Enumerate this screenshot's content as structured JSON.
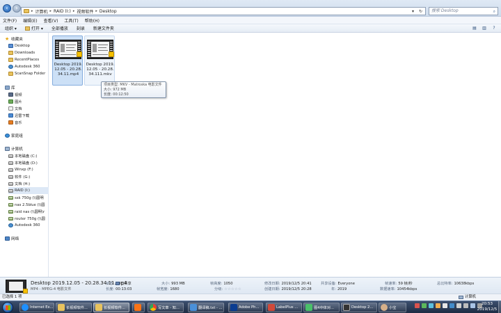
{
  "address_bar": {
    "path": [
      "计算机",
      "RAID (I:)",
      "视频软件",
      "Desktop"
    ],
    "search_placeholder": "搜索 Desktop"
  },
  "menu": [
    "文件(F)",
    "编辑(E)",
    "查看(V)",
    "工具(T)",
    "帮助(H)"
  ],
  "toolbar": {
    "organize": "组织 ▾",
    "open": "打开 ▾",
    "play_all": "全部播放",
    "burn": "刻录",
    "new_folder": "新建文件夹"
  },
  "nav": {
    "favorites": {
      "label": "收藏夹",
      "items": [
        "Desktop",
        "Downloads",
        "RecentPlaces",
        "Autodesk 360",
        "ScanSnap Folder"
      ]
    },
    "libraries": {
      "label": "库",
      "items": [
        "视频",
        "图片",
        "文档",
        "迅雷下载",
        "音乐"
      ]
    },
    "homegroup": {
      "label": "家庭组"
    },
    "computer": {
      "label": "计算机",
      "items": [
        "本地磁盘 (C:)",
        "本地磁盘 (D:)",
        "Winxp (F:)",
        "软件 (G:)",
        "文档 (H:)",
        "RAID (I:)",
        "ssk 750g (\\\\圆明",
        "nas 2.5blue (\\\\圆",
        "raid nas (\\\\圆明\\r",
        "router 750g (\\\\圆",
        "Autodesk 360"
      ]
    },
    "network": {
      "label": "网络"
    }
  },
  "files": [
    {
      "name": "Desktop 2019.12.05 - 20.28.34.11.mp4",
      "state": "selected"
    },
    {
      "name": "Desktop 2019.12.05 - 20.28.34.111.mkv",
      "state": "hover"
    }
  ],
  "tooltip": {
    "type": "项目类型: MKV - Matroska 电影文件",
    "size": "大小: 972 MB",
    "length": "长度: 00:12:50"
  },
  "details": {
    "name": "Desktop 2019.12.05 - 20.28.34.11.mp4",
    "type": "MP4 - MPEG-4 电影文件",
    "state_k": "状态:",
    "state_v": "已共享",
    "length_k": "长度:",
    "length_v": "00:13:03",
    "size_k": "大小:",
    "size_v": "993 MB",
    "framewidth_k": "帧宽度:",
    "framewidth_v": "1680",
    "frameheight_k": "帧高度:",
    "frameheight_v": "1050",
    "rating_k": "分级:",
    "rating_v": "☆☆☆☆☆",
    "modified_k": "修改日期:",
    "modified_v": "2019/12/5 20:41",
    "created_k": "创建日期:",
    "created_v": "2019/12/5 20:28",
    "shared_k": "共享设备:",
    "shared_v": "Everyone",
    "year_k": "年:",
    "year_v": "2019",
    "fps_k": "帧速率:",
    "fps_v": "59 帧/秒",
    "datarate_k": "数据速率:",
    "datarate_v": "10454kbps",
    "bitrate_k": "总比特率:",
    "bitrate_v": "10638kbps"
  },
  "status": {
    "left": "已选择 1 项",
    "right": "计算机"
  },
  "taskbar": {
    "buttons": [
      {
        "label": "Internet Ex...",
        "color": "#1e90ff"
      },
      {
        "label": "长视频软件...",
        "color": "#e8c35e"
      },
      {
        "label": "长视频软件...",
        "color": "#e8c35e"
      },
      {
        "label": "",
        "color": "#f97316"
      },
      {
        "label": "写文章 - 知...",
        "color": "#34a853"
      },
      {
        "label": "翻译稿.txt - ...",
        "color": "#4a90d9"
      },
      {
        "label": "Adobe Ph...",
        "color": "#0b3d91"
      },
      {
        "label": "LabelPlus ...",
        "color": "#d04a3a"
      },
      {
        "label": "图4中体对...",
        "color": "#4ac06a"
      },
      {
        "label": "Desktop 2...",
        "color": "#333333"
      },
      {
        "label": "小宝",
        "color": "#d6b08a"
      }
    ],
    "time": "20:53",
    "date": "2019/12/5"
  }
}
